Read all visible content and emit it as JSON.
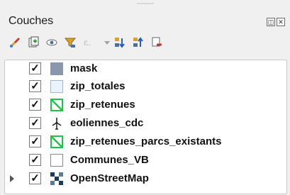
{
  "panel": {
    "title": "Couches",
    "float_icon": "float-icon",
    "close_icon": "close-icon"
  },
  "toolbar": {
    "icons": [
      "style-brush-icon",
      "add-group-icon",
      "eye-visibility-icon",
      "filter-icon",
      "expression-filter-icon",
      "dropdown-arrow-icon",
      "expand-all-icon",
      "collapse-all-icon",
      "remove-layer-icon"
    ]
  },
  "layers": [
    {
      "label": "mask",
      "checked": "✓",
      "symbol": "fill-slate",
      "expandable": false
    },
    {
      "label": "zip_totales",
      "checked": "✓",
      "symbol": "fill-lightblue",
      "expandable": false
    },
    {
      "label": "zip_retenues",
      "checked": "✓",
      "symbol": "hatch-green",
      "expandable": false
    },
    {
      "label": "eoliennes_cdc",
      "checked": "✓",
      "symbol": "wind-turbine",
      "expandable": false
    },
    {
      "label": "zip_retenues_parcs_existants",
      "checked": "✓",
      "symbol": "hatch-green",
      "expandable": false
    },
    {
      "label": "Communes_VB",
      "checked": "✓",
      "symbol": "fill-white",
      "expandable": false
    },
    {
      "label": "OpenStreetMap",
      "checked": "✓",
      "symbol": "raster-tiles",
      "expandable": true
    }
  ],
  "colors": {
    "mask_fill": "#8996ab",
    "zip_totales_fill": "#eaf2fb",
    "zip_totales_border": "#9fb6d0",
    "hatch_green": "#21c24a",
    "raster_dark": "#1d3a5c"
  }
}
